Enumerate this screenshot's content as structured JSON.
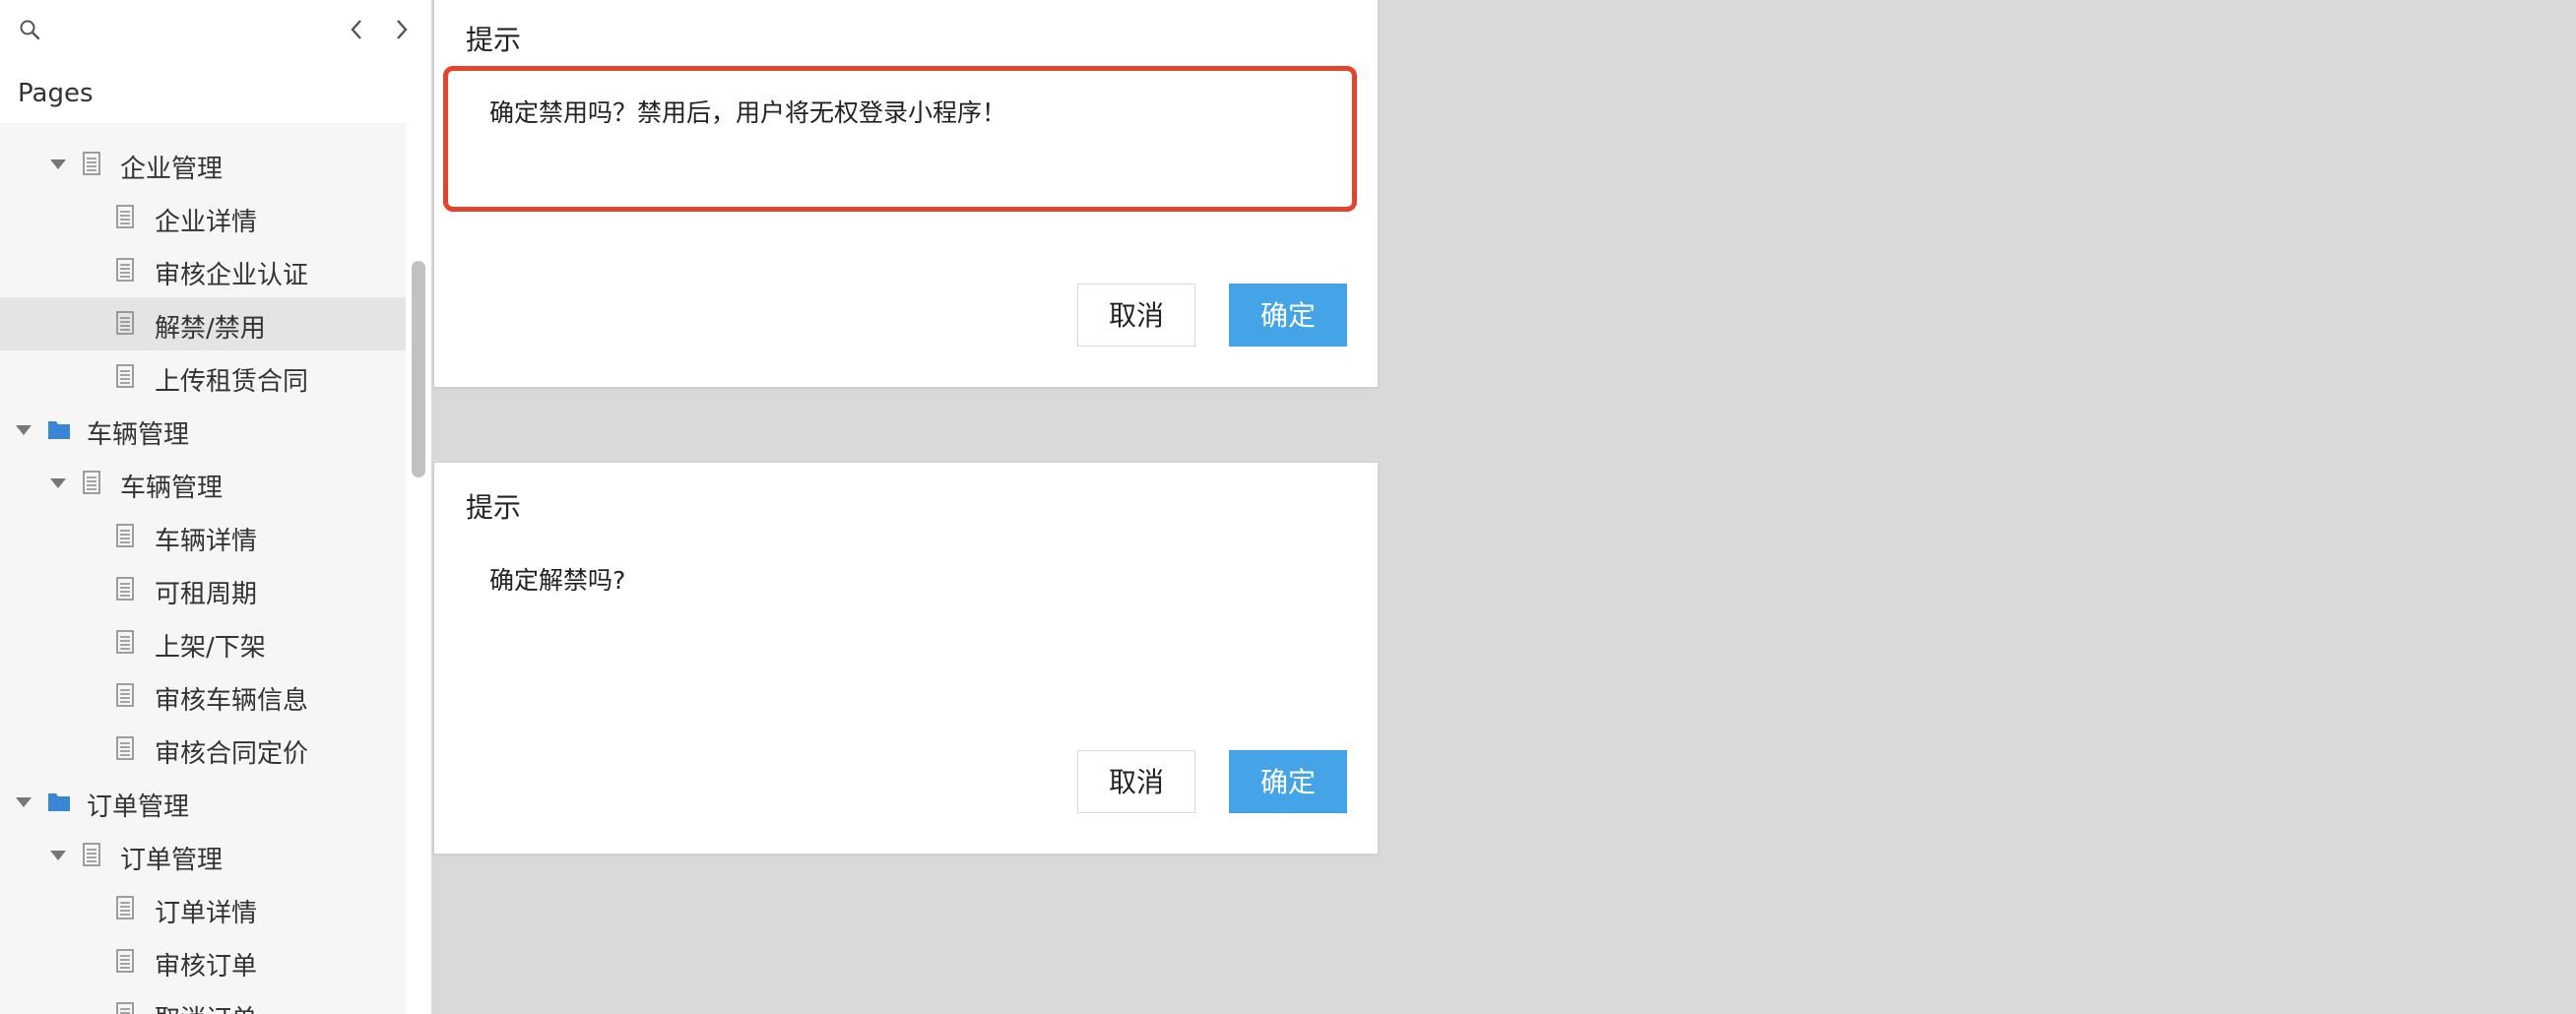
{
  "sidebar": {
    "pages_header": "Pages",
    "tree": [
      {
        "level": 1,
        "type": "page",
        "expanded": true,
        "label": "企业管理"
      },
      {
        "level": 2,
        "type": "page",
        "label": "企业详情"
      },
      {
        "level": 2,
        "type": "page",
        "label": "审核企业认证"
      },
      {
        "level": 2,
        "type": "page",
        "label": "解禁/禁用",
        "selected": true
      },
      {
        "level": 2,
        "type": "page",
        "label": "上传租赁合同"
      },
      {
        "level": 0,
        "type": "folder",
        "expanded": true,
        "label": "车辆管理"
      },
      {
        "level": 1,
        "type": "page",
        "expanded": true,
        "label": "车辆管理"
      },
      {
        "level": 2,
        "type": "page",
        "label": "车辆详情"
      },
      {
        "level": 2,
        "type": "page",
        "label": "可租周期"
      },
      {
        "level": 2,
        "type": "page",
        "label": "上架/下架"
      },
      {
        "level": 2,
        "type": "page",
        "label": "审核车辆信息"
      },
      {
        "level": 2,
        "type": "page",
        "label": "审核合同定价"
      },
      {
        "level": 0,
        "type": "folder",
        "expanded": true,
        "label": "订单管理"
      },
      {
        "level": 1,
        "type": "page",
        "expanded": true,
        "label": "订单管理"
      },
      {
        "level": 2,
        "type": "page",
        "label": "订单详情"
      },
      {
        "level": 2,
        "type": "page",
        "label": "审核订单"
      },
      {
        "level": 2,
        "type": "page",
        "label": "取消订单"
      }
    ]
  },
  "dialog_disable": {
    "title": "提示",
    "message": "确定禁用吗？禁用后，用户将无权登录小程序！",
    "cancel_label": "取消",
    "ok_label": "确定"
  },
  "dialog_unban": {
    "title": "提示",
    "message": "确定解禁吗?",
    "cancel_label": "取消",
    "ok_label": "确定"
  },
  "colors": {
    "primary_button": "#45a4e8",
    "highlight_border": "#e2442c",
    "folder_icon": "#3a86d6",
    "canvas_background": "#d9d9d9"
  }
}
